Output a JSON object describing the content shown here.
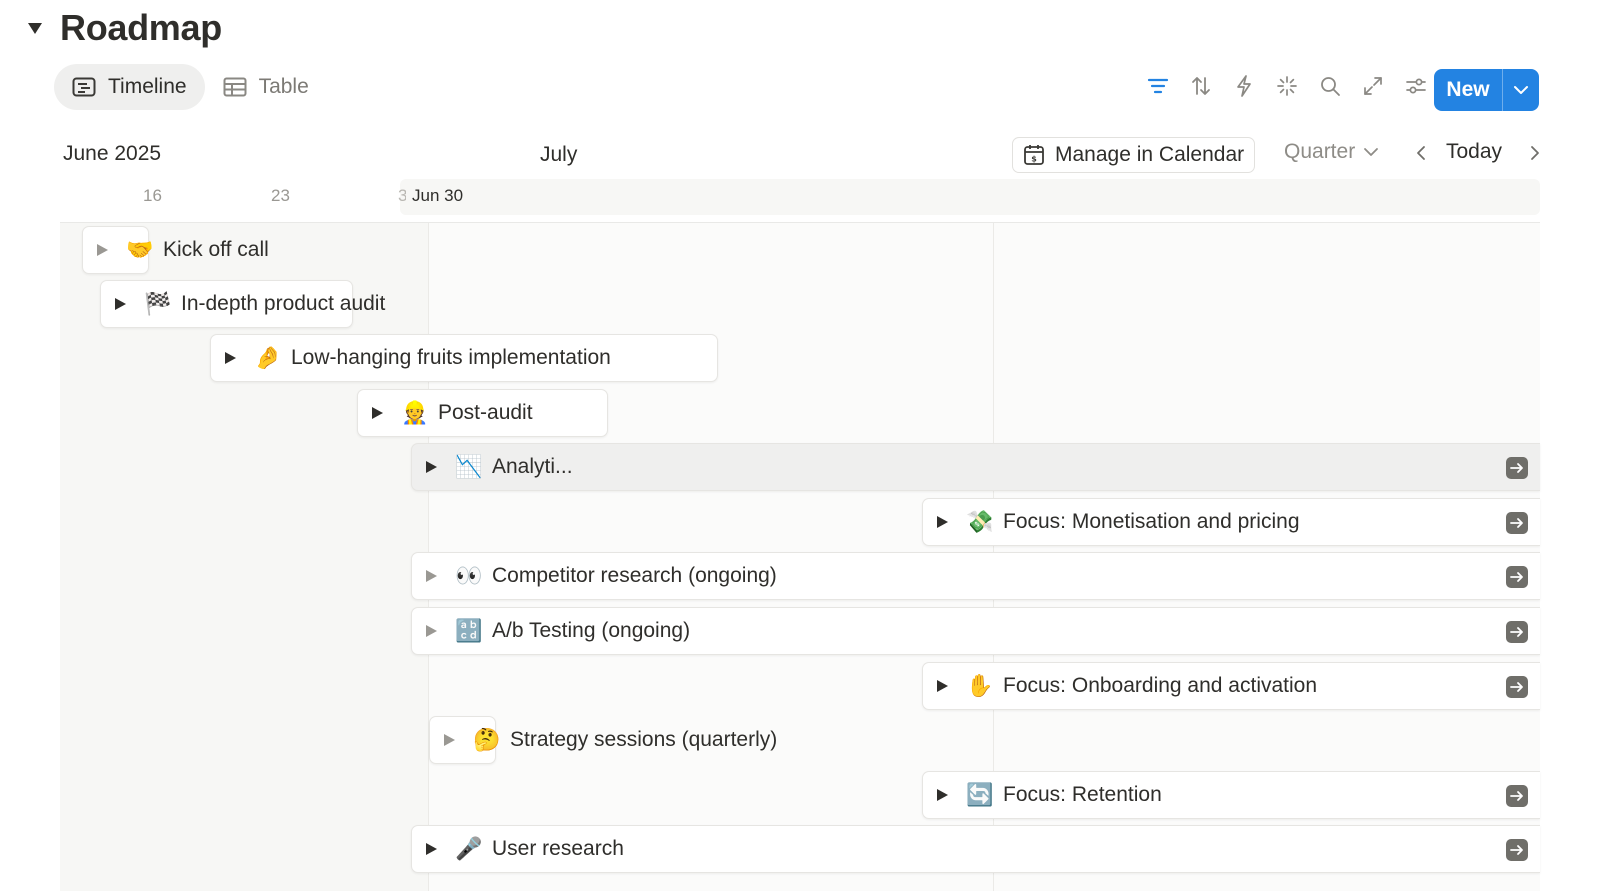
{
  "page": {
    "title": "Roadmap"
  },
  "views": [
    {
      "label": "Timeline",
      "icon": "timeline-icon",
      "active": true
    },
    {
      "label": "Table",
      "icon": "table-icon",
      "active": false
    }
  ],
  "toolbar": {
    "icons": [
      "filter-icon",
      "sort-icon",
      "automation-icon",
      "ai-sparkle-icon",
      "search-icon",
      "expand-icon",
      "settings-icon"
    ],
    "new_label": "New"
  },
  "timeline": {
    "months": [
      "June 2025",
      "July"
    ],
    "days": [
      "16",
      "23"
    ],
    "today_marker": "Jun 30",
    "manage_label": "Manage in Calendar",
    "range_label": "Quarter",
    "today_label": "Today"
  },
  "items": [
    {
      "emoji": "🤝",
      "label": "Kick off call"
    },
    {
      "emoji": "🏁",
      "label": "In-depth product audit"
    },
    {
      "emoji": "🤌",
      "label": "Low-hanging fruits implementation"
    },
    {
      "emoji": "👷",
      "label": "Post-audit"
    },
    {
      "emoji": "📉",
      "label": "Analyti..."
    },
    {
      "emoji": "💸",
      "label": "Focus: Monetisation and pricing"
    },
    {
      "emoji": "👀",
      "label": "Competitor research (ongoing)"
    },
    {
      "emoji": "🔡",
      "label": "A/b Testing (ongoing)"
    },
    {
      "emoji": "✋",
      "label": "Focus: Onboarding and activation"
    },
    {
      "emoji": "🤔",
      "label": "Strategy sessions (quarterly)"
    },
    {
      "emoji": "🔄",
      "label": "Focus: Retention"
    },
    {
      "emoji": "🎤",
      "label": "User research"
    }
  ],
  "colors": {
    "accent": "#2383e2",
    "text": "#37352f",
    "muted": "#9a9893"
  }
}
